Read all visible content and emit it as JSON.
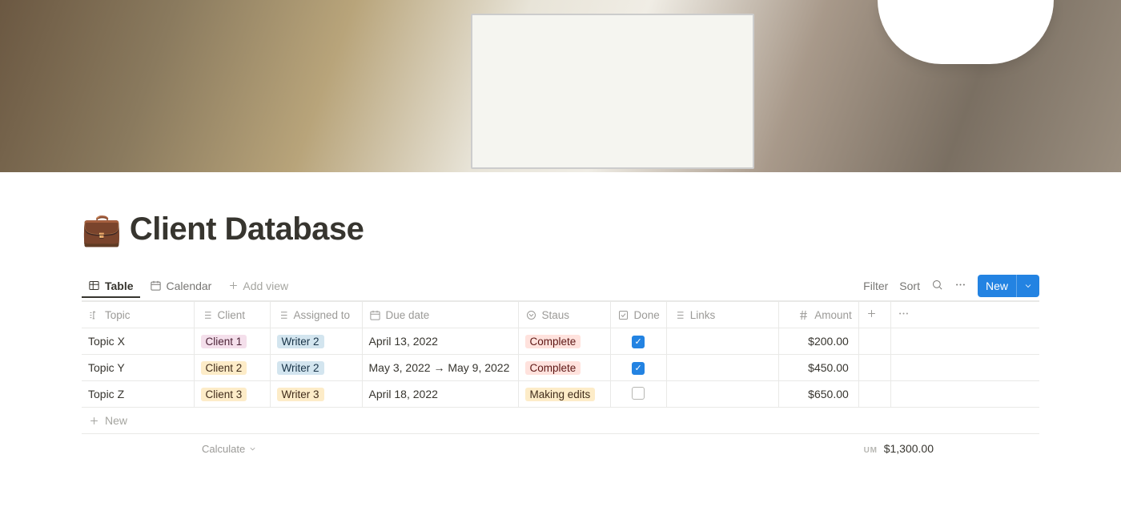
{
  "page": {
    "icon": "💼",
    "title": "Client Database"
  },
  "views": {
    "table": "Table",
    "calendar": "Calendar",
    "add_view": "Add view"
  },
  "toolbar": {
    "filter": "Filter",
    "sort": "Sort",
    "new": "New"
  },
  "columns": {
    "topic": "Topic",
    "client": "Client",
    "assigned": "Assigned to",
    "due": "Due date",
    "staus": "Staus",
    "done": "Done",
    "links": "Links",
    "amount": "Amount"
  },
  "rows": [
    {
      "topic": "Topic X",
      "client": {
        "label": "Client 1",
        "color": "pink"
      },
      "assigned": {
        "label": "Writer 2",
        "color": "blue"
      },
      "due": "April 13, 2022",
      "staus": {
        "label": "Complete",
        "color": "red"
      },
      "done": true,
      "links": "",
      "amount": "$200.00"
    },
    {
      "topic": "Topic Y",
      "client": {
        "label": "Client 2",
        "color": "yellow"
      },
      "assigned": {
        "label": "Writer 2",
        "color": "blue"
      },
      "due": "May 3, 2022 → May 9, 2022",
      "staus": {
        "label": "Complete",
        "color": "red"
      },
      "done": true,
      "links": "",
      "amount": "$450.00"
    },
    {
      "topic": "Topic Z",
      "client": {
        "label": "Client 3",
        "color": "yellow"
      },
      "assigned": {
        "label": "Writer 3",
        "color": "yellow"
      },
      "due": "April 18, 2022",
      "staus": {
        "label": "Making edits",
        "color": "yellow"
      },
      "done": false,
      "links": "",
      "amount": "$650.00"
    }
  ],
  "footer": {
    "new_row": "New",
    "calculate": "Calculate",
    "sum_label": "UM",
    "sum_value": "$1,300.00"
  }
}
